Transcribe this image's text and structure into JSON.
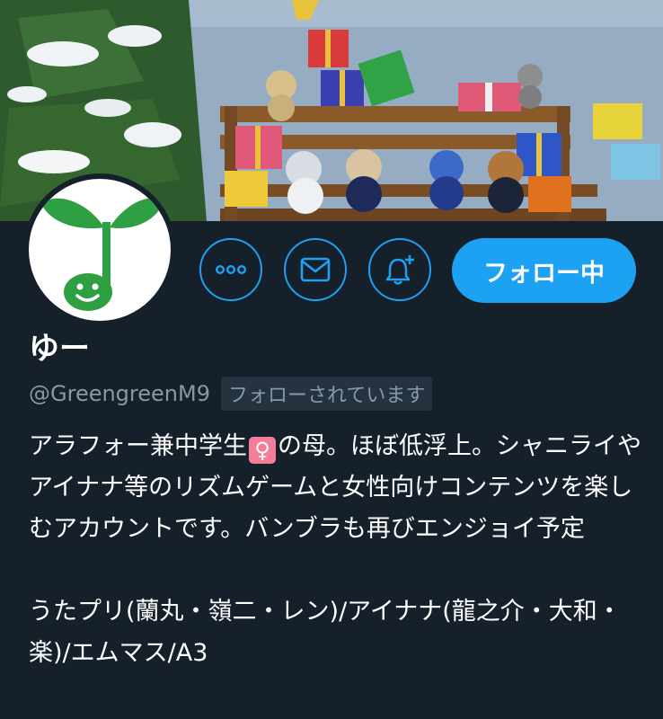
{
  "banner": {
    "image": "christmas-teddy-bears-window-display"
  },
  "avatar": {
    "image": "green-sprout-music-note-smiley",
    "color": "#2ea043"
  },
  "actions": {
    "more_icon": "more-horizontal-icon",
    "message_icon": "mail-icon",
    "notify_icon": "bell-plus-icon",
    "follow_label": "フォロー中"
  },
  "profile": {
    "display_name": "ゆー",
    "handle": "@GreengreenM9",
    "follows_you_label": "フォローされています",
    "bio": {
      "part1": "アラフォー兼中学生",
      "emoji": "♀",
      "part2": "の母。ほぼ低浮上。シャニライやアイナナ等のリズムゲームと女性向けコンテンツを楽しむアカウントです。バンブラも再びエンジョイ予定",
      "line2": "うたプリ(蘭丸・嶺二・レン)/アイナナ(龍之介・大和・楽)/エムマス/A3"
    }
  },
  "colors": {
    "background": "#15202b",
    "accent": "#1da1f2",
    "secondary_text": "#8899a6",
    "badge_bg": "#253341"
  }
}
